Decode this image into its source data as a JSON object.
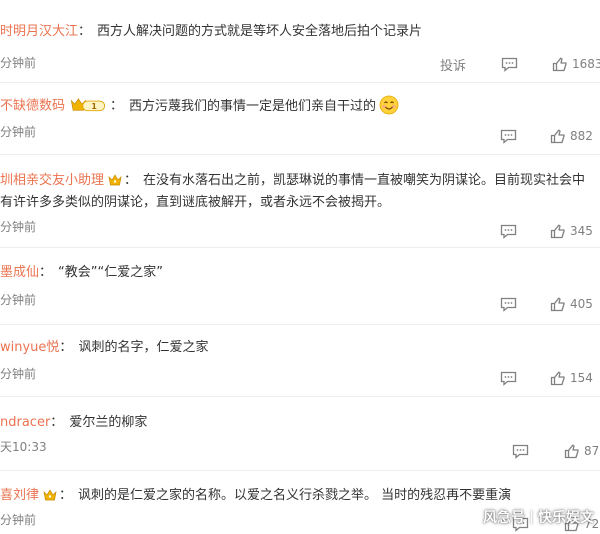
{
  "colors": {
    "username": "#eb7350",
    "text": "#333333",
    "meta": "#808080",
    "divider": "#eeeeee"
  },
  "comments": [
    {
      "user": "时明月汉大江",
      "sep": "：",
      "text": "西方人解决问题的方式就是等坏人安全落地后拍个记录片",
      "time": "分钟前",
      "report": "投诉",
      "likes": "1683",
      "badge": "none"
    },
    {
      "user": "不缺德数码",
      "sep": "：",
      "text": "西方污蔑我们的事情一定是他们亲自干过的",
      "time": "分钟前",
      "likes": "882",
      "badge": "crown-level",
      "level_badge_text": "1",
      "emoji": "smile-emoji"
    },
    {
      "user": "圳相亲交友小助理",
      "sep": "：",
      "text": "在没有水落石出之前，凯瑟琳说的事情一直被嘲笑为阴谋论。目前现实社会中",
      "text2": "有许许多多类似的阴谋论，直到谜底被解开，或者永远不会被揭开。",
      "time": "分钟前",
      "likes": "345",
      "badge": "crown"
    },
    {
      "user": "墨成仙",
      "sep": "：",
      "text": "“教会”“仁爱之家”",
      "time": "分钟前",
      "likes": "405",
      "badge": "none"
    },
    {
      "user": "winyue悦",
      "sep": "：",
      "text": "讽刺的名字，仁爱之家",
      "time": "分钟前",
      "likes": "154",
      "badge": "none"
    },
    {
      "user": "ndracer",
      "sep": "：",
      "text": "爱尔兰的柳家",
      "time": "天10:33",
      "likes": "87",
      "badge": "none"
    },
    {
      "user": "喜刘律",
      "sep": "：",
      "text": "讽刺的是仁爱之家的名称。以爱之名义行杀戮之举。 当时的残忍再不要重演",
      "time": "分钟前",
      "likes": "72",
      "badge": "crown"
    }
  ],
  "watermark": {
    "left": "风急号",
    "right": "快乐娱文"
  }
}
